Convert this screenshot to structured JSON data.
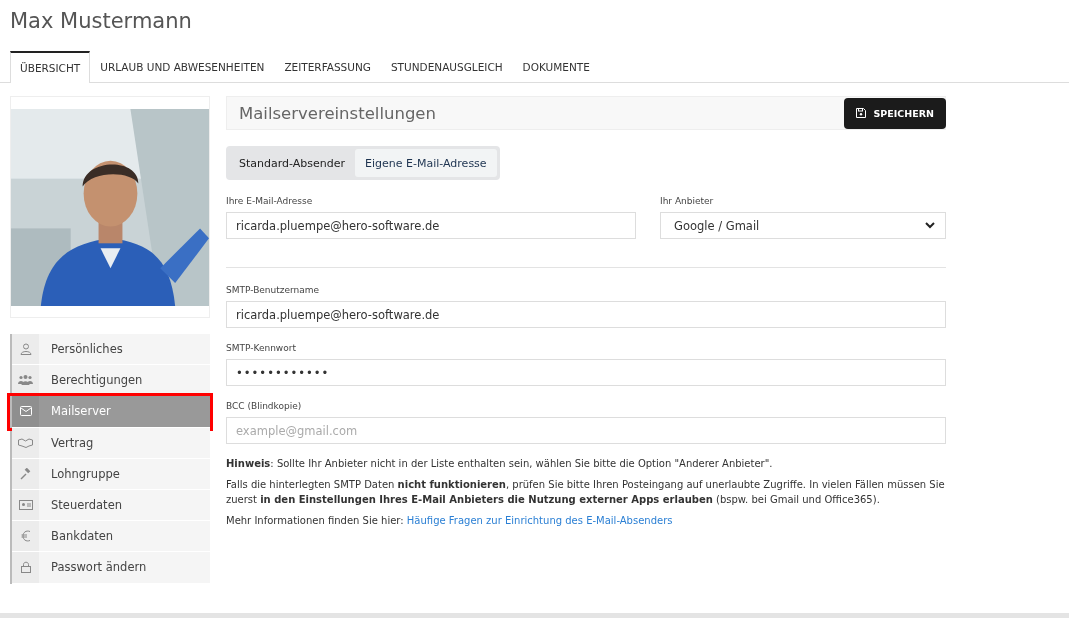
{
  "page_title": "Max Mustermann",
  "tabs": [
    {
      "label": "ÜBERSICHT",
      "selected": true
    },
    {
      "label": "URLAUB UND ABWESENHEITEN",
      "selected": false
    },
    {
      "label": "ZEITERFASSUNG",
      "selected": false
    },
    {
      "label": "STUNDENAUSGLEICH",
      "selected": false
    },
    {
      "label": "DOKUMENTE",
      "selected": false
    }
  ],
  "sidebar": {
    "items": [
      {
        "label": "Persönliches",
        "kind": "person",
        "selected": false,
        "annotated": false
      },
      {
        "label": "Berechtigungen",
        "kind": "group",
        "selected": false,
        "annotated": false
      },
      {
        "label": "Mailserver",
        "kind": "mail",
        "selected": true,
        "annotated": true
      },
      {
        "label": "Vertrag",
        "kind": "handshake",
        "selected": false,
        "annotated": false
      },
      {
        "label": "Lohngruppe",
        "kind": "gavel",
        "selected": false,
        "annotated": false
      },
      {
        "label": "Steuerdaten",
        "kind": "idcard",
        "selected": false,
        "annotated": false
      },
      {
        "label": "Bankdaten",
        "kind": "euro",
        "selected": false,
        "annotated": false
      },
      {
        "label": "Passwort ändern",
        "kind": "lock",
        "selected": false,
        "annotated": false
      }
    ]
  },
  "panel": {
    "title": "Mailservereinstellungen",
    "save_button": "SPEICHERN",
    "sender_toggle": [
      {
        "label": "Standard-Absender",
        "selected": false
      },
      {
        "label": "Eigene E-Mail-Adresse",
        "selected": true
      }
    ],
    "email": {
      "label": "Ihre E-Mail-Adresse",
      "value": "ricarda.pluempe@hero-software.de"
    },
    "provider": {
      "label": "Ihr Anbieter",
      "value": "Google / Gmail"
    },
    "smtp_user": {
      "label": "SMTP-Benutzername",
      "value": "ricarda.pluempe@hero-software.de"
    },
    "smtp_password": {
      "label": "SMTP-Kennwort",
      "value": "••••••••••••"
    },
    "bcc": {
      "label": "BCC (Blindkopie)",
      "placeholder": "example@gmail.com"
    },
    "notes": [
      "**Hinweis**: Sollte Ihr Anbieter nicht in der Liste enthalten sein, wählen Sie bitte die Option \"Anderer Anbieter\".",
      "Falls die hinterlegten SMTP Daten **nicht funktionieren**, prüfen Sie bitte Ihren Posteingang auf unerlaubte Zugriffe. In vielen Fällen müssen Sie zuerst **in den Einstellungen Ihres E-Mail Anbieters die Nutzung externer Apps erlauben** (bspw. bei Gmail und Office365)."
    ],
    "more_info": {
      "text": "Mehr Informationen finden Sie hier:",
      "link": "Häufige Fragen zur Einrichtung des E-Mail-Absenders"
    }
  }
}
